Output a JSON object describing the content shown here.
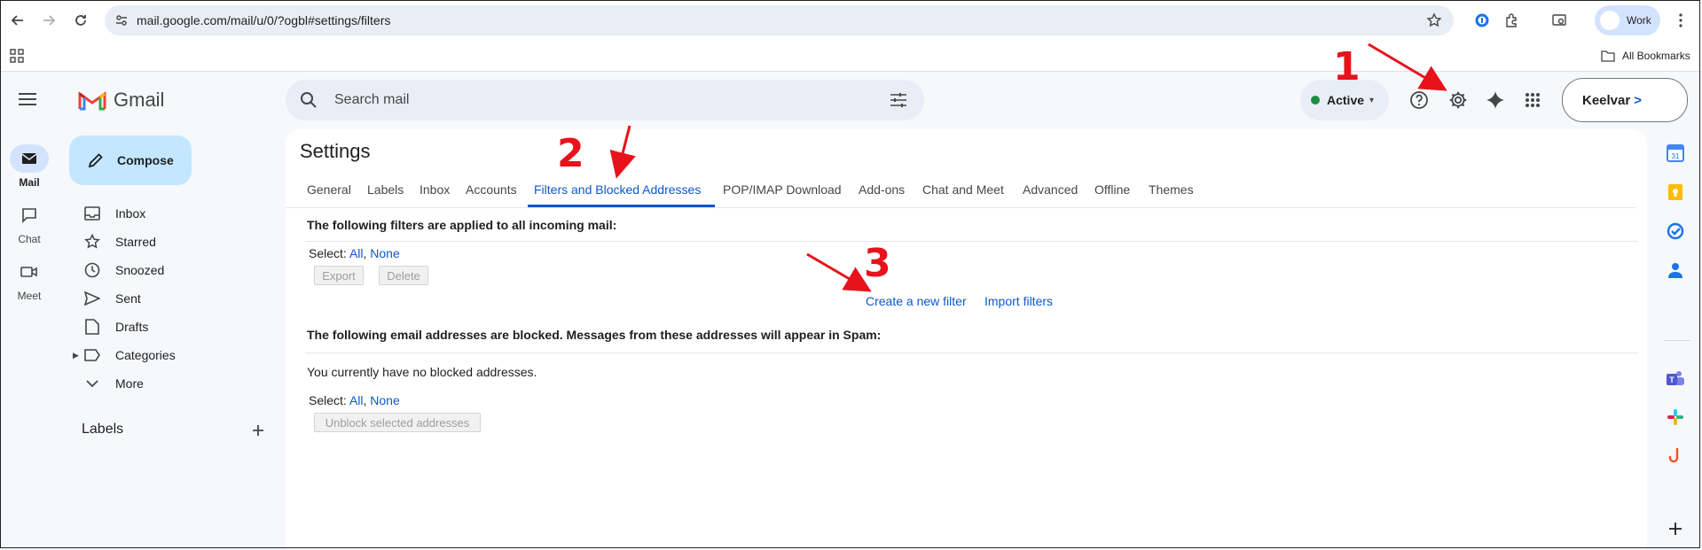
{
  "browser": {
    "url": "mail.google.com/mail/u/0/?ogbl#settings/filters",
    "profile_label": "Work",
    "bookmarks_label": "All Bookmarks"
  },
  "gmail": {
    "logo_text": "Gmail",
    "compose_label": "Compose",
    "search_placeholder": "Search mail",
    "status_label": "Active",
    "account_name": "Keelvar",
    "rail": [
      {
        "label": "Mail"
      },
      {
        "label": "Chat"
      },
      {
        "label": "Meet"
      }
    ],
    "nav": [
      {
        "label": "Inbox",
        "icon": "inbox-icon"
      },
      {
        "label": "Starred",
        "icon": "star-icon"
      },
      {
        "label": "Snoozed",
        "icon": "clock-icon"
      },
      {
        "label": "Sent",
        "icon": "send-icon"
      },
      {
        "label": "Drafts",
        "icon": "draft-icon"
      },
      {
        "label": "Categories",
        "icon": "label-icon"
      },
      {
        "label": "More",
        "icon": "chevron-down-icon"
      }
    ],
    "labels_heading": "Labels"
  },
  "settings": {
    "title": "Settings",
    "tabs": [
      "General",
      "Labels",
      "Inbox",
      "Accounts",
      "Filters and Blocked Addresses",
      "POP/IMAP Download",
      "Add-ons",
      "Chat and Meet",
      "Advanced",
      "Offline",
      "Themes"
    ],
    "active_tab": "Filters and Blocked Addresses",
    "filters_heading": "The following filters are applied to all incoming mail:",
    "select_label": "Select:",
    "select_all": "All",
    "select_none": "None",
    "export_label": "Export",
    "delete_label": "Delete",
    "create_filter": "Create a new filter",
    "import_filters": "Import filters",
    "blocked_heading": "The following email addresses are blocked. Messages from these addresses will appear in Spam:",
    "blocked_empty": "You currently have no blocked addresses.",
    "unblock_label": "Unblock selected addresses"
  },
  "annotations": [
    "1",
    "2",
    "3"
  ],
  "colors": {
    "accent": "#0b57d0",
    "annotation": "#e8121b",
    "compose": "#c2e7ff"
  }
}
